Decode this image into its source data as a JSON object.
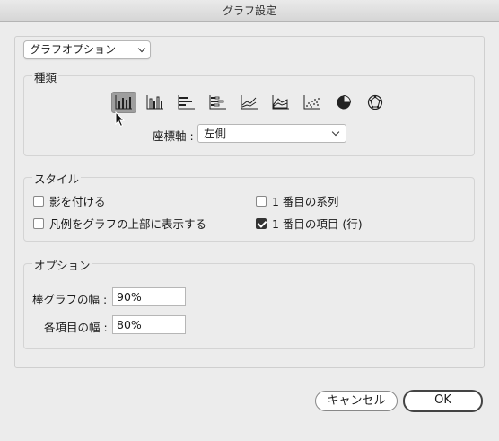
{
  "window": {
    "title": "グラフ設定"
  },
  "panel_selector": {
    "value": "グラフオプション"
  },
  "chart_type": {
    "legend": "種類",
    "icons": [
      {
        "name": "vertical-bar-icon",
        "selected": true
      },
      {
        "name": "stacked-bar-icon",
        "selected": false
      },
      {
        "name": "horizontal-bar-icon",
        "selected": false
      },
      {
        "name": "horizontal-stacked-bar-icon",
        "selected": false
      },
      {
        "name": "line-chart-icon",
        "selected": false
      },
      {
        "name": "area-chart-icon",
        "selected": false
      },
      {
        "name": "scatter-chart-icon",
        "selected": false
      },
      {
        "name": "pie-chart-icon",
        "selected": false
      },
      {
        "name": "radar-chart-icon",
        "selected": false
      }
    ],
    "axis_label": "座標軸 :",
    "axis_value": "左側"
  },
  "style": {
    "legend": "スタイル",
    "shadow": {
      "label": "影を付ける",
      "checked": false
    },
    "legend_top": {
      "label": "凡例をグラフの上部に表示する",
      "checked": false
    },
    "first_row": {
      "label": "1 番目の系列",
      "checked": false
    },
    "first_column": {
      "label": "1 番目の項目 (行)",
      "checked": true
    }
  },
  "options": {
    "legend": "オプション",
    "bar_width_label": "棒グラフの幅 :",
    "bar_width_value": "90%",
    "cluster_width_label": "各項目の幅 :",
    "cluster_width_value": "80%"
  },
  "buttons": {
    "cancel": "キャンセル",
    "ok": "OK"
  }
}
